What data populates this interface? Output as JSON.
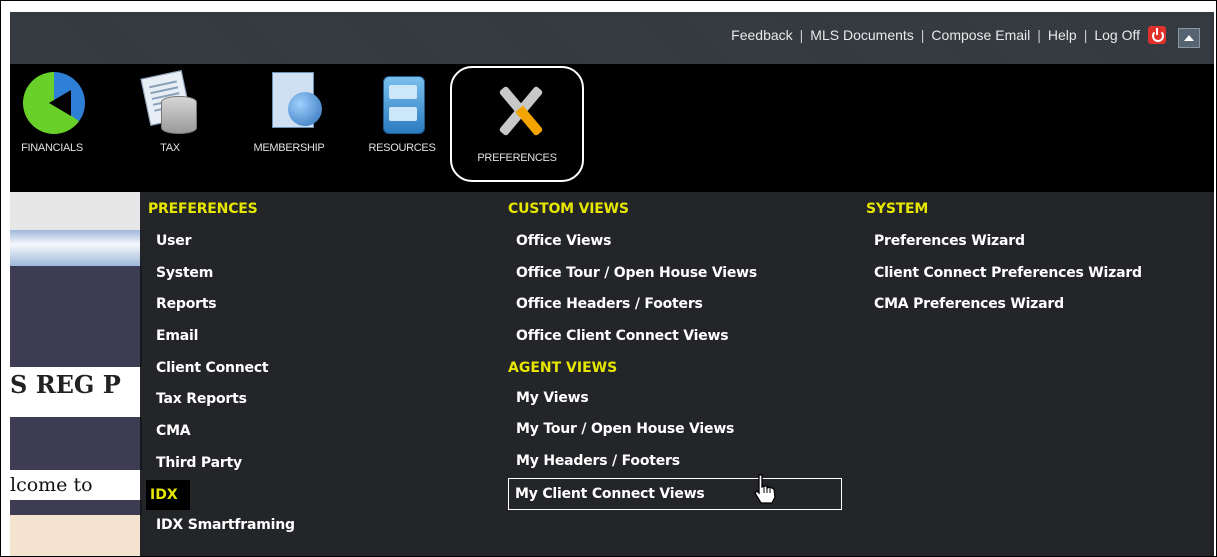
{
  "topbar": {
    "links": [
      "Feedback",
      "MLS Documents",
      "Compose Email",
      "Help",
      "Log Off"
    ],
    "separator": "|"
  },
  "iconbar": {
    "items": [
      {
        "label": "FINANCIALS",
        "icon": "pie-chart-icon"
      },
      {
        "label": "TAX",
        "icon": "tax-documents-icon"
      },
      {
        "label": "MEMBERSHIP",
        "icon": "membership-globe-icon"
      },
      {
        "label": "RESOURCES",
        "icon": "file-cabinet-icon"
      },
      {
        "label": "PREFERENCES",
        "icon": "tools-icon",
        "active": true
      }
    ]
  },
  "dropdown": {
    "preferences": {
      "heading": "PREFERENCES",
      "items": [
        "User",
        "System",
        "Reports",
        "Email",
        "Client Connect",
        "Tax Reports",
        "CMA",
        "Third Party"
      ],
      "idx_heading": "IDX",
      "idx_items": [
        "IDX Smartframing"
      ]
    },
    "custom_views": {
      "heading": "CUSTOM VIEWS",
      "items": [
        "Office Views",
        "Office Tour / Open House Views",
        "Office Headers / Footers",
        "Office Client Connect Views"
      ],
      "agent_heading": "AGENT VIEWS",
      "agent_items": [
        "My Views",
        "My Tour / Open House Views",
        "My Headers / Footers",
        "My Client Connect Views"
      ]
    },
    "system": {
      "heading": "SYSTEM",
      "items": [
        "Preferences Wizard",
        "Client Connect Preferences Wizard",
        "CMA Preferences Wizard"
      ]
    }
  },
  "background": {
    "heading_fragment": "S REG P",
    "welcome_fragment": "lcome to"
  },
  "colors": {
    "menu_heading": "#e6e600",
    "menu_item": "#ffffff",
    "logoff_icon": "#e0302a"
  }
}
